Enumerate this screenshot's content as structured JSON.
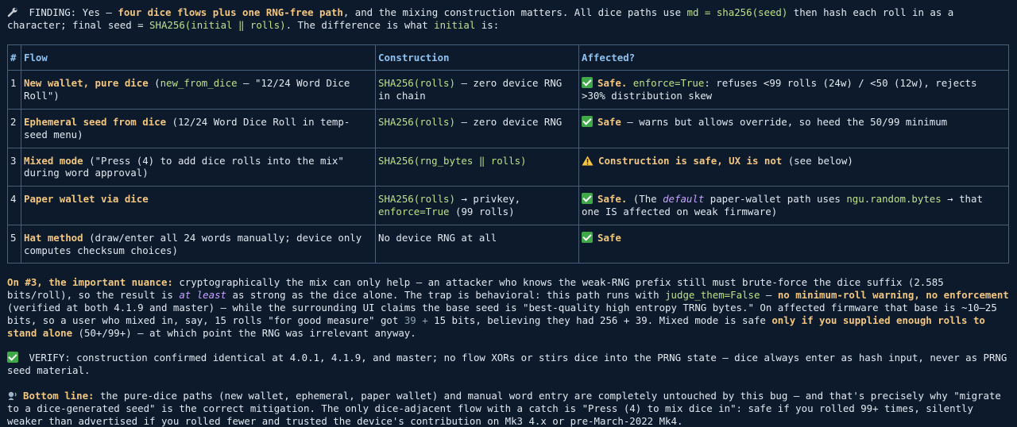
{
  "finding": {
    "prefix": " FINDING: Yes — ",
    "bold": "four dice flows plus one RNG-free path",
    "t1": ", and the mixing construction matters. All dice paths use ",
    "code1": "md = sha256(seed)",
    "t2": " then hash each roll in as a character; final seed = ",
    "code2": "SHA256(initial ‖ rolls)",
    "t3": ". The difference is what ",
    "code3": "initial",
    "t4": " is:"
  },
  "table": {
    "headers": [
      "#",
      "Flow",
      "Construction",
      "Affected?"
    ],
    "rows": [
      {
        "num": "1",
        "flow_bold": "New wallet, pure dice",
        "flow_t1": " (",
        "flow_code": "new_from_dice",
        "flow_t2": " — \"12/24 Word Dice Roll\")",
        "cons_code": "SHA256(rolls)",
        "cons_t": " — zero device RNG in chain",
        "aff_bold": "Safe.",
        "aff_code": "enforce=True",
        "aff_t": ": refuses <99 rolls (24w) / <50 (12w), rejects >30% distribution skew"
      },
      {
        "num": "2",
        "flow_bold": "Ephemeral seed from dice",
        "flow_t1": " (12/24 Word Dice Roll in temp-seed menu)",
        "cons_code": "SHA256(rolls)",
        "cons_t": " — zero device RNG",
        "aff_bold": "Safe",
        "aff_t": " — warns but allows override, so heed the 50/99 minimum"
      },
      {
        "num": "3",
        "flow_bold": "Mixed mode",
        "flow_t1": " (\"Press (4) to add dice rolls into the mix\" during word approval)",
        "cons_code": "SHA256(rng_bytes ‖ rolls)",
        "aff_bold": "Construction is safe, UX is not",
        "aff_t": " (see below)"
      },
      {
        "num": "4",
        "flow_bold": "Paper wallet via dice",
        "cons_code": "SHA256(rolls)",
        "cons_t": " → privkey, ",
        "cons_code2": "enforce=True",
        "cons_t2": " (99 rolls)",
        "aff_bold": "Safe.",
        "aff_t1": " (The ",
        "aff_em": "default",
        "aff_t2": " paper-wallet path uses ",
        "aff_code": "ngu.random.bytes",
        "aff_t3": " → that one IS affected on weak firmware)"
      },
      {
        "num": "5",
        "flow_bold": "Hat method",
        "flow_t1": " (draw/enter all 24 words manually; device only computes checksum choices)",
        "cons_t": "No device RNG at all",
        "aff_bold": "Safe"
      }
    ]
  },
  "nuance": {
    "bold": "On #3, the important nuance:",
    "t1": " cryptographically the mix can only help — an attacker who knows the weak-RNG prefix still must brute-force the dice suffix (2.585 bits/roll), so the result is ",
    "em": "at least",
    "t2": " as strong as the dice alone. The trap is behavioral: this path runs with ",
    "code": "judge_them=False",
    "t3": " — ",
    "bold2": "no minimum-roll warning, no enforcement",
    "t4": " (verified at both 4.1.9 and master) — while the surrounding UI claims the base seed is \"best-quality high entropy TRNG bytes.\" On affected firmware that base is ~10–25 bits, so a user who mixed in, say, 15 rolls \"for good measure\" got ",
    "grey": "39 +",
    "t5": " 15 bits, believing they had 256 + 39. Mixed mode is safe ",
    "bold3": "only if you supplied enough rolls to stand alone",
    "t6": " (50+/99+) — at which point the RNG was irrelevant anyway."
  },
  "verify": {
    "text": " VERIFY: construction confirmed identical at 4.0.1, 4.1.9, and master; no flow XORs or stirs dice into the PRNG state — dice always enter as hash input, never as PRNG seed material."
  },
  "bottom": {
    "bold": "Bottom line:",
    "text": " the pure-dice paths (new wallet, ephemeral, paper wallet) and manual word entry are completely untouched by this bug — and that's precisely why \"migrate to a dice-generated seed\" is the correct mitigation. The only dice-adjacent flow with a catch is \"Press (4) to mix dice in\": safe if you rolled 99+ times, silently weaker than advertised if you rolled fewer and trusted the device's contribution on Mk3 4.x or pre-March-2022 Mk4."
  },
  "icons": {
    "finding": "wrench-icon",
    "safe": "check-icon",
    "warn": "warning-icon",
    "bottom": "speaker-icon"
  },
  "colors": {
    "background": "#0c1a2b",
    "text": "#e2e8f0",
    "accent": "#f3c680",
    "code": "#bfe08a",
    "header": "#8fc2f0",
    "check": "#41a84a"
  }
}
